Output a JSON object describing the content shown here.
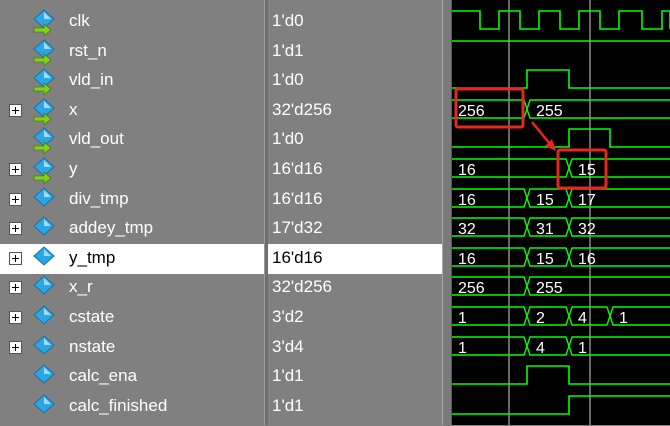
{
  "signals": [
    {
      "name": "clk",
      "value": "1'd0",
      "expandable": false,
      "arrow": true
    },
    {
      "name": "rst_n",
      "value": "1'd1",
      "expandable": false,
      "arrow": true
    },
    {
      "name": "vld_in",
      "value": "1'd0",
      "expandable": false,
      "arrow": true
    },
    {
      "name": "x",
      "value": "32'd256",
      "expandable": true,
      "arrow": true
    },
    {
      "name": "vld_out",
      "value": "1'd0",
      "expandable": false,
      "arrow": true
    },
    {
      "name": "y",
      "value": "16'd16",
      "expandable": true,
      "arrow": true
    },
    {
      "name": "div_tmp",
      "value": "16'd16",
      "expandable": true,
      "arrow": false
    },
    {
      "name": "addey_tmp",
      "value": "17'd32",
      "expandable": true,
      "arrow": false
    },
    {
      "name": "y_tmp",
      "value": "16'd16",
      "expandable": true,
      "arrow": false,
      "selected": true
    },
    {
      "name": "x_r",
      "value": "32'd256",
      "expandable": true,
      "arrow": false
    },
    {
      "name": "cstate",
      "value": "3'd2",
      "expandable": true,
      "arrow": false
    },
    {
      "name": "nstate",
      "value": "3'd4",
      "expandable": true,
      "arrow": false
    },
    {
      "name": "calc_ena",
      "value": "1'd1",
      "expandable": false,
      "arrow": false
    },
    {
      "name": "calc_finished",
      "value": "1'd1",
      "expandable": false,
      "arrow": false
    }
  ],
  "wave_labels": {
    "x": [
      "256",
      "255"
    ],
    "y": [
      "16",
      "15"
    ],
    "div_tmp": [
      "16",
      "15",
      "17"
    ],
    "addey_tmp": [
      "32",
      "31",
      "32"
    ],
    "y_tmp": [
      "16",
      "15",
      "16"
    ],
    "x_r": [
      "256",
      "255"
    ],
    "cstate": [
      "1",
      "2",
      "4",
      "1"
    ],
    "nstate": [
      "1",
      "4",
      "1"
    ]
  },
  "colors": {
    "wave": "#00ff00",
    "cursor": "#ffffff",
    "highlight": "#e8281e",
    "icon": "#2aa5e6",
    "arrow": "#7fd11b"
  }
}
